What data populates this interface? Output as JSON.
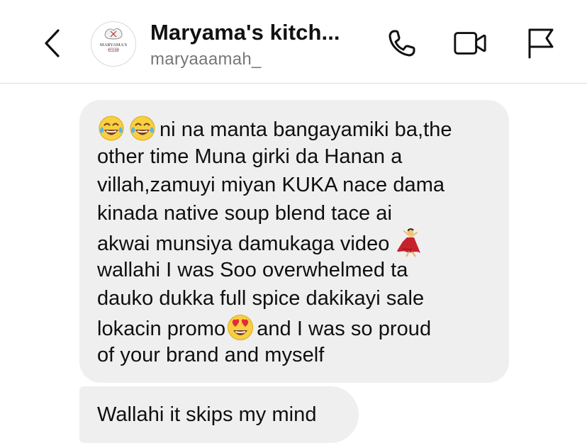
{
  "header": {
    "back_icon": "chevron-left-icon",
    "avatar_text": "MARYAMA'S",
    "avatar_subtext": "KITCHEN",
    "title": "Maryama's kitch...",
    "subtitle": "maryaaamah_",
    "icons": [
      "phone-icon",
      "video-camera-icon",
      "flag-icon"
    ]
  },
  "messages": [
    {
      "lines": [
        {
          "pre_emoji": [
            "face-with-tears-of-joy",
            "face-with-tears-of-joy"
          ],
          "text": "ni na manta bangayamiki ba,the"
        },
        {
          "text": "other time Muna girki da Hanan a"
        },
        {
          "text": "villah,zamuyi miyan KUKA nace dama"
        },
        {
          "text": "kinada native soup blend tace ai"
        },
        {
          "text": "akwai munsiya damukaga video",
          "post_emoji": "woman-dancing"
        },
        {
          "text": "wallahi I was Soo overwhelmed ta"
        },
        {
          "text": "dauko dukka full spice dakikayi sale"
        },
        {
          "text": "lokacin promo",
          "mid_emoji": "smiling-face-with-heart-eyes",
          "text_after": "and I was so proud"
        },
        {
          "text": "of your brand and myself"
        }
      ]
    },
    {
      "text": "Wallahi it skips my mind"
    }
  ],
  "colors": {
    "bubble": "#efefef",
    "subtitle": "#777777",
    "divider": "#dcdcdc"
  }
}
